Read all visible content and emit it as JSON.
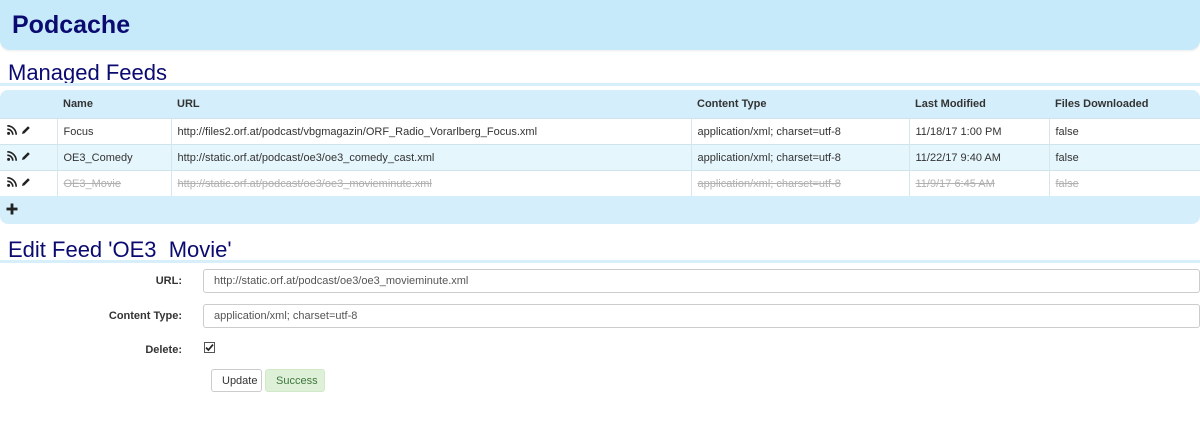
{
  "app": {
    "title": "Podcache"
  },
  "feeds": {
    "section_title": "Managed Feeds",
    "columns": [
      "",
      "Name",
      "URL",
      "Content Type",
      "Last Modified",
      "Files Downloaded"
    ],
    "rows": [
      {
        "name": "Focus",
        "url": "http://files2.orf.at/podcast/vbgmagazin/ORF_Radio_Vorarlberg_Focus.xml",
        "content_type": "application/xml; charset=utf-8",
        "last_modified": "11/18/17 1:00 PM",
        "files_downloaded": "false",
        "deleted": false
      },
      {
        "name": "OE3_Comedy",
        "url": "http://static.orf.at/podcast/oe3/oe3_comedy_cast.xml",
        "content_type": "application/xml; charset=utf-8",
        "last_modified": "11/22/17 9:40 AM",
        "files_downloaded": "false",
        "deleted": false
      },
      {
        "name": "OE3_Movie",
        "url": "http://static.orf.at/podcast/oe3/oe3_movieminute.xml",
        "content_type": "application/xml; charset=utf-8",
        "last_modified": "11/9/17 6:45 AM",
        "files_downloaded": "false",
        "deleted": true
      }
    ],
    "row_icons": [
      "rss-icon",
      "pencil-icon"
    ],
    "add_icon": "plus-icon"
  },
  "edit": {
    "section_title": "Edit Feed 'OE3_Movie'",
    "url_label": "URL:",
    "url_value": "http://static.orf.at/podcast/oe3/oe3_movieminute.xml",
    "content_type_label": "Content Type:",
    "content_type_value": "application/xml; charset=utf-8",
    "delete_label": "Delete:",
    "delete_checked": true,
    "update_button": "Update",
    "status_button": "Success"
  },
  "colors": {
    "header_bg": "#c6eafa",
    "title": "#0a0a70",
    "row_alt": "#e6f6fd",
    "success_bg": "#dff0d8",
    "success_text": "#3c763d"
  }
}
